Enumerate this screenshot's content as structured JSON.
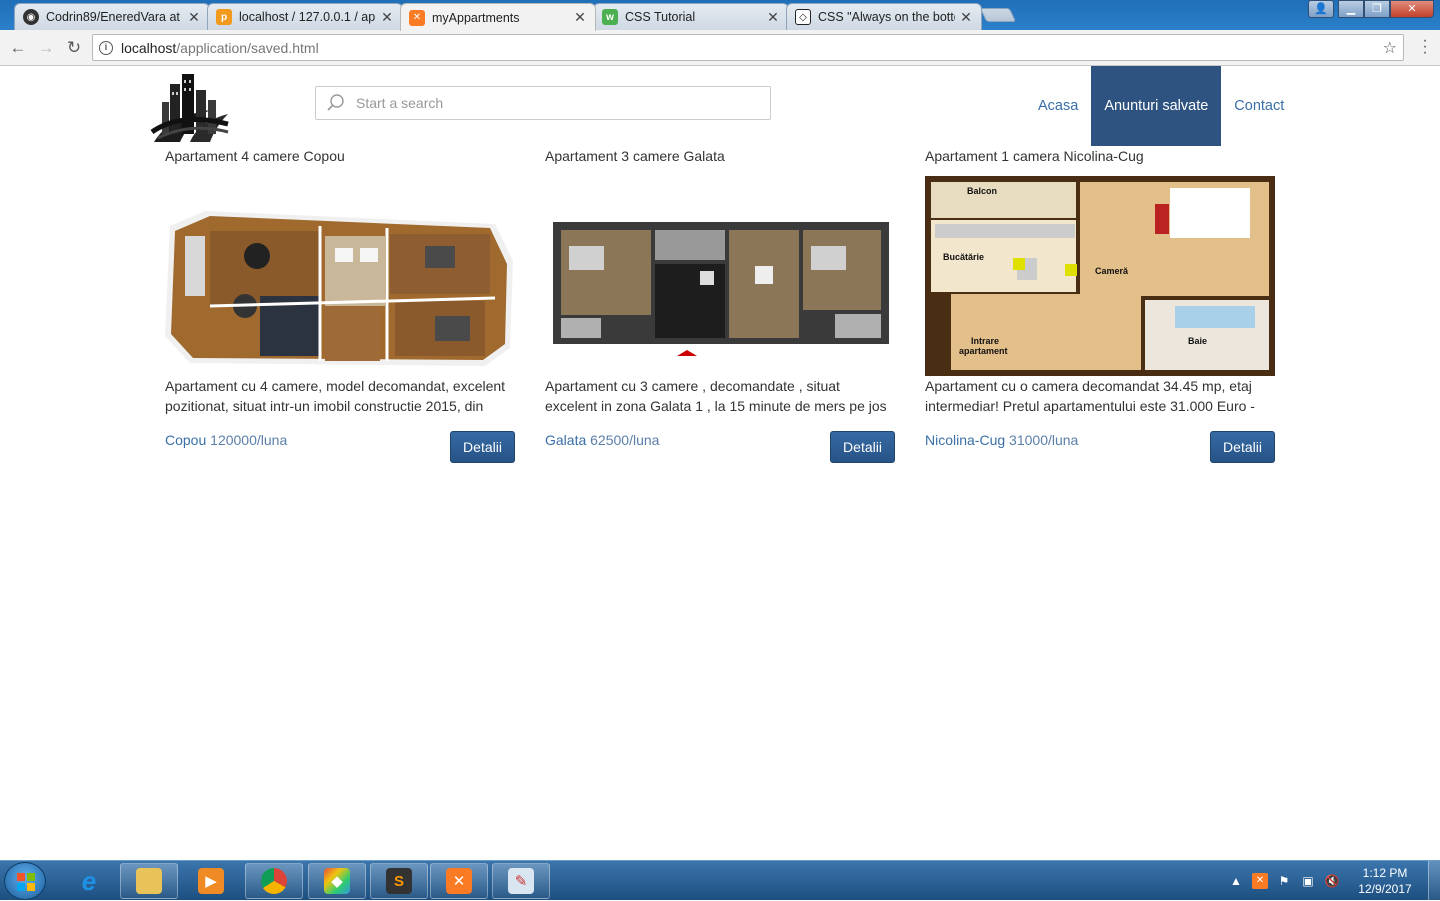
{
  "browser": {
    "tabs": [
      {
        "title": "Codrin89/EneredVara at",
        "icon": "github-icon",
        "color": "#333333"
      },
      {
        "title": "localhost / 127.0.0.1 / ap",
        "icon": "phpmyadmin-icon",
        "color": "#f29a1e"
      },
      {
        "title": "myAppartments",
        "icon": "xampp-icon",
        "color": "#fb7a24"
      },
      {
        "title": "CSS Tutorial",
        "icon": "w3schools-icon",
        "color": "#4caf50"
      },
      {
        "title": "CSS \"Always on the botto",
        "icon": "codepen-icon",
        "color": "#222222"
      }
    ],
    "url_host": "localhost",
    "url_path": "/application/saved.html"
  },
  "site": {
    "search_placeholder": "Start a search",
    "nav": [
      "Acasa",
      "Anunturi salvate",
      "Contact"
    ],
    "nav_active": "Anunturi salvate",
    "accent": "#2e5381"
  },
  "listings": [
    {
      "title": "Apartament 4 camere Copou",
      "description": "Apartament cu 4 camere, model decomandat, excelent pozitionat, situat intr-un imobil constructie 2015, din",
      "area": "Copou",
      "price": "120000/luna",
      "button": "Detalii"
    },
    {
      "title": "Apartament 3 camere Galata",
      "description": "Apartament cu 3 camere , decomandate , situat excelent in zona Galata 1 , la 15 minute de mers pe jos",
      "area": "Galata",
      "price": "62500/luna",
      "button": "Detalii"
    },
    {
      "title": "Apartament 1 camera Nicolina-Cug",
      "description": "Apartament cu o camera decomandat 34.45 mp, etaj intermediar! Pretul apartamentului este 31.000 Euro -",
      "area": "Nicolina-Cug",
      "price": "31000/luna",
      "button": "Detalii"
    }
  ],
  "floorplan3": {
    "balcon": "Balcon",
    "bucatarie": "Bucătărie",
    "camera": "Cameră",
    "baie": "Baie",
    "intrare1": "Intrare",
    "intrare2": "apartament"
  },
  "taskbar": {
    "time": "1:12 PM",
    "date": "12/9/2017"
  }
}
